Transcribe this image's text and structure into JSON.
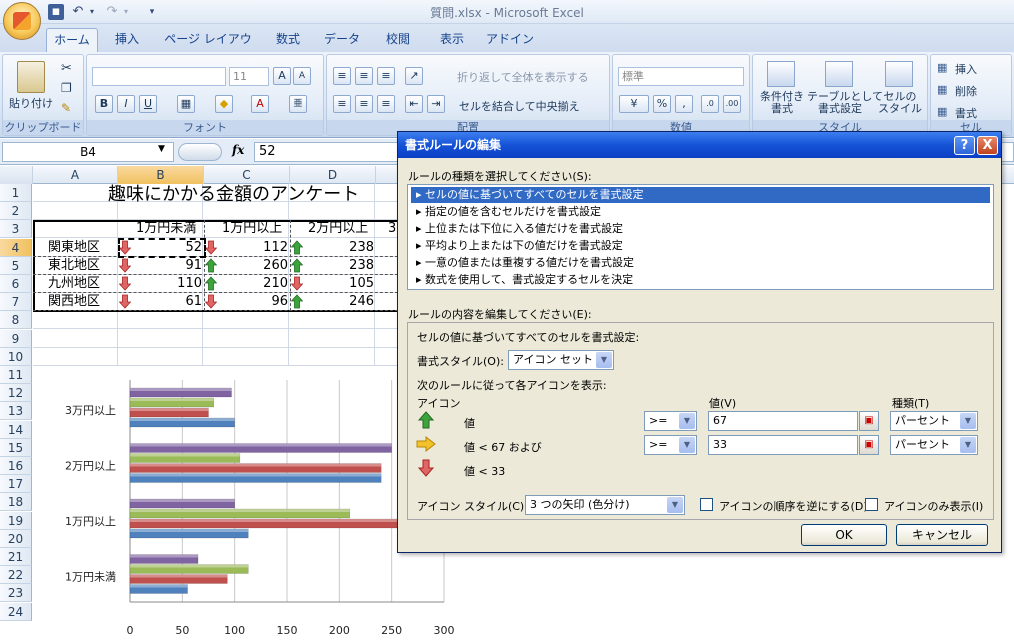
{
  "window": {
    "title": "質問.xlsx - Microsoft Excel"
  },
  "tabs": [
    "ホーム",
    "挿入",
    "ページ レイアウト",
    "数式",
    "データ",
    "校閲",
    "表示",
    "アドイン"
  ],
  "ribbon": {
    "clipboard": {
      "paste": "貼り付け",
      "label": "クリップボード"
    },
    "font": {
      "size": "11",
      "label": "フォント"
    },
    "alignment": {
      "wrap": "折り返して全体を表示する",
      "merge": "セルを結合して中央揃え",
      "label": "配置"
    },
    "number": {
      "format": "標準",
      "label": "数値"
    },
    "styles": {
      "cond1": "条件付き",
      "cond2": "書式",
      "table1": "テーブルとして",
      "table2": "書式設定",
      "cell1": "セルの",
      "cell2": "スタイル",
      "label": "スタイル"
    },
    "cells": {
      "insert": "挿入",
      "delete": "削除",
      "format": "書式",
      "label": "セル"
    }
  },
  "formula_bar": {
    "name_box": "B4",
    "fx": "fx",
    "value": "52"
  },
  "columns": [
    "A",
    "B",
    "C",
    "D"
  ],
  "rows": [
    "1",
    "2",
    "3",
    "4",
    "5",
    "6",
    "7",
    "8",
    "9",
    "10",
    "11",
    "12",
    "13",
    "14",
    "15",
    "16",
    "17",
    "18",
    "19",
    "20",
    "21",
    "22",
    "23",
    "24"
  ],
  "sheet": {
    "title": "趣味にかかる金額のアンケート",
    "headers": [
      "1万円未満",
      "1万円以上",
      "2万円以上",
      "3"
    ],
    "data": [
      {
        "region": "関東地区",
        "b": "52",
        "c": "112",
        "d": "238",
        "ab": "down",
        "ac": "down",
        "ad": "up"
      },
      {
        "region": "東北地区",
        "b": "91",
        "c": "260",
        "d": "238",
        "ab": "down",
        "ac": "up",
        "ad": "up"
      },
      {
        "region": "九州地区",
        "b": "110",
        "c": "210",
        "d": "105",
        "ab": "down",
        "ac": "up",
        "ad": "down"
      },
      {
        "region": "関西地区",
        "b": "61",
        "c": "96",
        "d": "246",
        "ab": "down",
        "ac": "down",
        "ad": "up"
      }
    ]
  },
  "chart_data": {
    "type": "bar",
    "categories": [
      "3万円以上",
      "2万円以上",
      "1万円以上",
      "1万円未満"
    ],
    "series": [
      {
        "color": "#4f81bd",
        "values": [
          100,
          240,
          113,
          55
        ]
      },
      {
        "color": "#c0504d",
        "values": [
          75,
          240,
          260,
          93
        ]
      },
      {
        "color": "#9bbb59",
        "values": [
          80,
          105,
          210,
          113
        ]
      },
      {
        "color": "#8064a2",
        "values": [
          97,
          250,
          100,
          65
        ]
      }
    ],
    "xticks": [
      "0",
      "50",
      "100",
      "150",
      "200",
      "250",
      "300"
    ],
    "xlim": [
      0,
      300
    ]
  },
  "dialog": {
    "title": "書式ルールの編集",
    "help": "?",
    "close": "X",
    "select_rule_label": "ルールの種類を選択してください(S):",
    "rules": [
      "▸ セルの値に基づいてすべてのセルを書式設定",
      "▸ 指定の値を含むセルだけを書式設定",
      "▸ 上位または下位に入る値だけを書式設定",
      "▸ 平均より上または下の値だけを書式設定",
      "▸ 一意の値または重複する値だけを書式設定",
      "▸ 数式を使用して、書式設定するセルを決定"
    ],
    "edit_label": "ルールの内容を編集してください(E):",
    "desc": "セルの値に基づいてすべてのセルを書式設定:",
    "style_label": "書式スタイル(O):",
    "style_value": "アイコン セット",
    "rule_caption": "次のルールに従って各アイコンを表示:",
    "icon_col": "アイコン",
    "value_col": "値(V)",
    "type_col": "種類(T)",
    "row1_text": "値",
    "row1_op": ">=",
    "row1_val": "67",
    "row1_type": "パーセント",
    "row2_text": "値 < 67 および",
    "row2_op": ">=",
    "row2_val": "33",
    "row2_type": "パーセント",
    "row3_text": "値 < 33",
    "icon_style_label": "アイコン スタイル(C):",
    "icon_style_value": "3 つの矢印 (色分け)",
    "reverse_label": "アイコンの順序を逆にする(D)",
    "icon_only_label": "アイコンのみ表示(I)",
    "ok": "OK",
    "cancel": "キャンセル"
  }
}
